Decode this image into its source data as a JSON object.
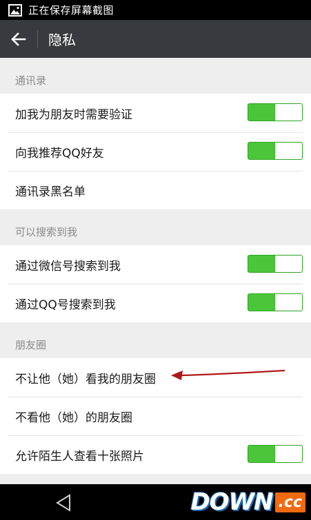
{
  "status_bar": {
    "icon": "image-icon",
    "text": "正在保存屏幕截图"
  },
  "app_bar": {
    "back_icon": "arrow-left-icon",
    "title": "隐私"
  },
  "sections": [
    {
      "header": "通讯录",
      "rows": [
        {
          "label": "加我为朋友时需要验证",
          "toggle": true,
          "on": true
        },
        {
          "label": "向我推荐QQ好友",
          "toggle": true,
          "on": true
        },
        {
          "label": "通讯录黑名单",
          "toggle": false
        }
      ]
    },
    {
      "header": "可以搜索到我",
      "rows": [
        {
          "label": "通过微信号搜索到我",
          "toggle": true,
          "on": true
        },
        {
          "label": "通过QQ号搜索到我",
          "toggle": true,
          "on": true
        }
      ]
    },
    {
      "header": "朋友圈",
      "rows": [
        {
          "label": "不让他（她）看我的朋友圈",
          "toggle": false
        },
        {
          "label": "不看他（她）的朋友圈",
          "toggle": false
        },
        {
          "label": "允许陌生人查看十张照片",
          "toggle": true,
          "on": true
        }
      ]
    }
  ],
  "nav_bar": {
    "back_icon": "triangle-back-icon"
  },
  "watermark": {
    "main": "DOWN",
    "tld": ".cc"
  },
  "colors": {
    "toggle_on": "#4bc63a",
    "app_bar": "#393a3f",
    "annotation_arrow": "#b01818"
  }
}
